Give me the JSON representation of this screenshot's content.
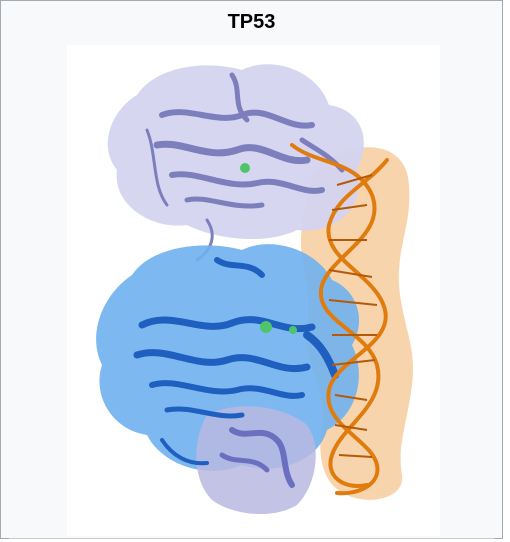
{
  "infobox": {
    "title": "TP53"
  },
  "image": {
    "subject": "protein-dna-complex-illustration",
    "colors": {
      "upper_domain_surface": "#c9c9ea",
      "upper_domain_ribbon": "#7d7fbd",
      "lower_domain_surface": "#6fb1ee",
      "lower_domain_ribbon": "#1f5fbf",
      "bottom_domain_surface": "#b8b8e0",
      "dna_surface": "#f6c690",
      "dna_backbone": "#e07c0e",
      "ion_spheres": "#4fc46a"
    }
  }
}
